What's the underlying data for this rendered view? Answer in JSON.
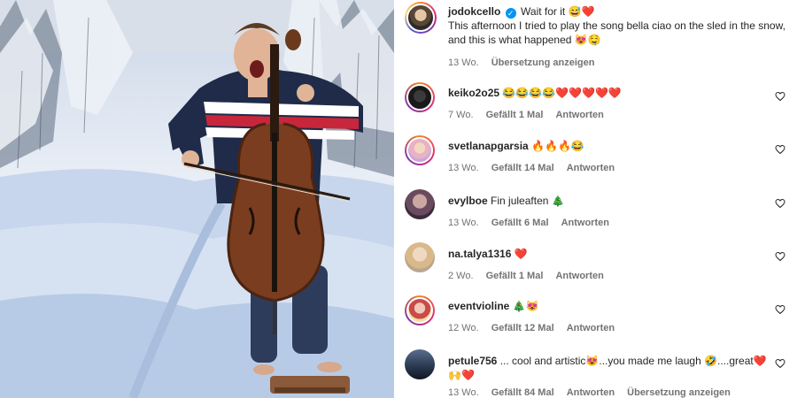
{
  "post": {
    "author": "jodokcello",
    "title_text": "Wait for it 😅❤️",
    "caption": "This afternoon I tried to play the song bella ciao on the sled in the snow, and this is what happened 😻🤤",
    "age": "13 Wo.",
    "translate_label": "Übersetzung anzeigen"
  },
  "colors": {
    "verified": "#0095f6",
    "secondary_text": "#737373",
    "text": "#262626",
    "story_ring": "#dd2a7b"
  },
  "comments": [
    {
      "username": "keiko2o25",
      "text": "😂😂😂😂❤️❤️❤️❤️❤️",
      "age": "7 Wo.",
      "likes": "Gefällt 1 Mal",
      "reply": "Antworten"
    },
    {
      "username": "svetlanapgarsia",
      "text": "🔥🔥🔥😂",
      "age": "13 Wo.",
      "likes": "Gefällt 14 Mal",
      "reply": "Antworten"
    },
    {
      "username": "evylboe",
      "text": "Fin juleaften 🎄",
      "age": "13 Wo.",
      "likes": "Gefällt 6 Mal",
      "reply": "Antworten"
    },
    {
      "username": "na.talya1316",
      "text": "❤️",
      "age": "2 Wo.",
      "likes": "Gefällt 1 Mal",
      "reply": "Antworten"
    },
    {
      "username": "eventviolinе",
      "text": "🎄😻",
      "age": "12 Wo.",
      "likes": "Gefällt 12 Mal",
      "reply": "Antworten"
    },
    {
      "username": "petule756",
      "text": "... cool and artistic😻...you made me laugh 🤣....great❤️🙌❤️",
      "age": "13 Wo.",
      "likes": "Gefällt 84 Mal",
      "reply": "Antworten",
      "translate": "Übersetzung anzeigen"
    }
  ],
  "icons": {
    "like": "heart-outline-icon",
    "verified": "verified-badge-icon"
  }
}
